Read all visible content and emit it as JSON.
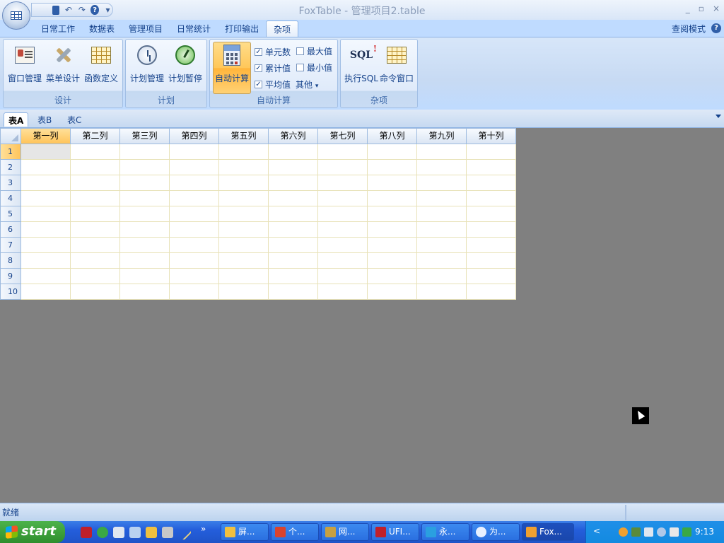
{
  "window": {
    "title": "FoxTable - 管理项目2.table",
    "minimize": "_",
    "restore": "▫",
    "close": "×"
  },
  "quick_access": {
    "undo": "↶",
    "redo": "↷",
    "help": "?",
    "more": "▾"
  },
  "ribbon_tabs": [
    {
      "label": "日常工作"
    },
    {
      "label": "数据表"
    },
    {
      "label": "管理项目"
    },
    {
      "label": "日常统计"
    },
    {
      "label": "打印输出"
    },
    {
      "label": "杂项"
    }
  ],
  "active_tab": "杂项",
  "view_mode": {
    "label": "查阅模式",
    "help": "?"
  },
  "groups": {
    "design": {
      "label": "设计",
      "buttons": [
        {
          "label": "窗口管理"
        },
        {
          "label": "菜单设计"
        },
        {
          "label": "函数定义"
        }
      ]
    },
    "plan": {
      "label": "计划",
      "buttons": [
        {
          "label": "计划管理"
        },
        {
          "label": "计划暂停"
        }
      ]
    },
    "autocalc": {
      "label": "自动计算",
      "button": "自动计算",
      "checks": [
        {
          "label": "单元数",
          "checked": true
        },
        {
          "label": "累计值",
          "checked": true
        },
        {
          "label": "平均值",
          "checked": true
        },
        {
          "label": "最大值",
          "checked": false
        },
        {
          "label": "最小值",
          "checked": false
        }
      ],
      "others": "其他"
    },
    "misc": {
      "label": "杂项",
      "buttons": [
        {
          "label": "执行SQL",
          "icon_text": "SQL"
        },
        {
          "label": "命令窗口"
        }
      ]
    }
  },
  "check_mark": "✓",
  "sheet_tabs": [
    {
      "label": "表A",
      "active": true
    },
    {
      "label": "表B",
      "active": false
    },
    {
      "label": "表C",
      "active": false
    }
  ],
  "grid": {
    "columns": [
      "第一列",
      "第二列",
      "第三列",
      "第四列",
      "第五列",
      "第六列",
      "第七列",
      "第八列",
      "第九列",
      "第十列"
    ],
    "rows": [
      "1",
      "2",
      "3",
      "4",
      "5",
      "6",
      "7",
      "8",
      "9",
      "10"
    ],
    "selected_column": 0,
    "selected_row": 0
  },
  "status": {
    "text": "就绪"
  },
  "taskbar": {
    "start_label": "start",
    "overflow": "»",
    "tasks": [
      {
        "label": "屏...",
        "icon_color": "#f0c040"
      },
      {
        "label": "个...",
        "icon_color": "#d9432e"
      },
      {
        "label": "网...",
        "icon_color": "#c8a040"
      },
      {
        "label": "UFI...",
        "icon_color": "#c0202a"
      },
      {
        "label": "永...",
        "icon_color": "#2aa0e0"
      },
      {
        "label": "为...",
        "icon_color": "#e8f0ff"
      },
      {
        "label": "Fox...",
        "icon_color": "#f0a030"
      }
    ],
    "tray_arrow": "<",
    "clock": "9:13"
  }
}
